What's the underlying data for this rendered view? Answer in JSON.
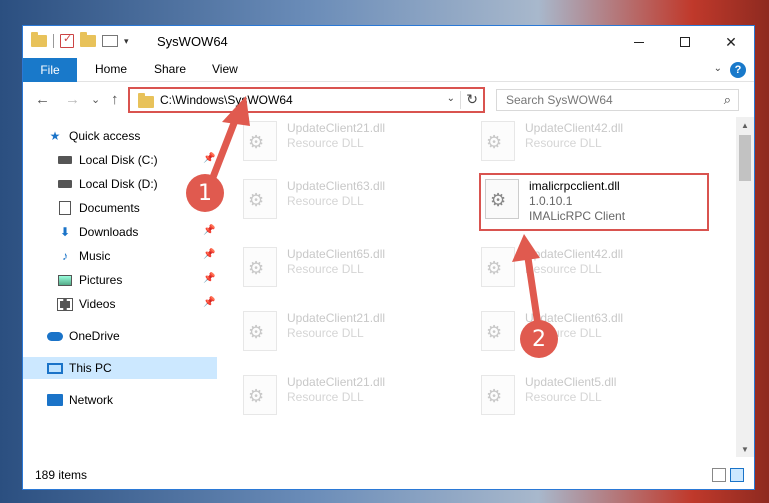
{
  "window": {
    "title": "SysWOW64",
    "controls": {
      "minimize": "",
      "maximize": "",
      "close": "✕"
    }
  },
  "ribbon": {
    "tabs": [
      "File",
      "Home",
      "Share",
      "View"
    ],
    "help": "?"
  },
  "nav": {
    "back": "←",
    "forward": "→",
    "recent": "⌄",
    "up": "↑",
    "address": "C:\\Windows\\SysWOW64",
    "address_dropdown": "⌄",
    "refresh": "↻",
    "search_placeholder": "Search SysWOW64",
    "search_icon": "⌕"
  },
  "sidebar": {
    "items": [
      {
        "label": "Quick access",
        "icon": "star-icon"
      },
      {
        "label": "Local Disk (C:)",
        "icon": "disk-icon",
        "pinned": true
      },
      {
        "label": "Local Disk (D:)",
        "icon": "disk-icon"
      },
      {
        "label": "Documents",
        "icon": "document-icon",
        "pinned": true
      },
      {
        "label": "Downloads",
        "icon": "download-icon",
        "pinned": true
      },
      {
        "label": "Music",
        "icon": "music-icon",
        "pinned": true
      },
      {
        "label": "Pictures",
        "icon": "pictures-icon",
        "pinned": true
      },
      {
        "label": "Videos",
        "icon": "videos-icon",
        "pinned": true
      },
      {
        "label": "OneDrive",
        "icon": "cloud-icon"
      },
      {
        "label": "This PC",
        "icon": "computer-icon",
        "selected": true
      },
      {
        "label": "Network",
        "icon": "network-icon"
      }
    ]
  },
  "files": [
    {
      "name": "UpdateClient21.dll",
      "desc": "Resource DLL"
    },
    {
      "name": "UpdateClient42.dll",
      "desc": "Resource DLL"
    },
    {
      "name": "UpdateClient63.dll",
      "desc": "Resource DLL"
    },
    {
      "name": "imalicrpcclient.dll",
      "version": "1.0.10.1",
      "desc": "IMALicRPC Client",
      "highlighted": true
    },
    {
      "name": "UpdateClient65.dll",
      "desc": "Resource DLL"
    },
    {
      "name": "UpdateClient42.dll",
      "desc": "Resource DLL"
    },
    {
      "name": "UpdateClient21.dll",
      "desc": "Resource DLL"
    },
    {
      "name": "UpdateClient63.dll",
      "desc": "Resource DLL"
    },
    {
      "name": "UpdateClient21.dll",
      "desc": "Resource DLL"
    },
    {
      "name": "UpdateClient5.dll",
      "desc": "Resource DLL"
    }
  ],
  "status": {
    "items": "189 items"
  },
  "annotations": {
    "step1": "1",
    "step2": "2"
  },
  "colors": {
    "accent": "#1979ca",
    "highlight": "#d9534f",
    "badge": "#e05a4f"
  }
}
